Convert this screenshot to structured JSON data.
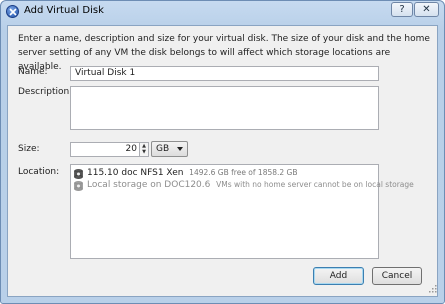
{
  "window": {
    "title": "Add Virtual Disk"
  },
  "title_buttons": {
    "help": "?",
    "close": "✕"
  },
  "intro_text": "Enter a name, description and size for your virtual disk. The size of your disk and the home server setting of any VM the disk belongs to will affect which storage locations are available.",
  "form": {
    "name_label": "Name:",
    "name_value": "Virtual Disk 1",
    "description_label": "Description:",
    "description_value": "",
    "size_label": "Size:",
    "size_value": "20",
    "size_unit": "GB",
    "location_label": "Location:"
  },
  "locations": [
    {
      "name": "115.10 doc NFS1 Xen",
      "detail": "1492.6 GB free of 1858.2 GB",
      "enabled": true,
      "icon": "storage-icon"
    },
    {
      "name": "Local storage on DOC120.6",
      "detail": "VMs with no home server cannot be on local storage",
      "enabled": false,
      "icon": "storage-icon"
    }
  ],
  "buttons": {
    "add": "Add",
    "cancel": "Cancel"
  }
}
